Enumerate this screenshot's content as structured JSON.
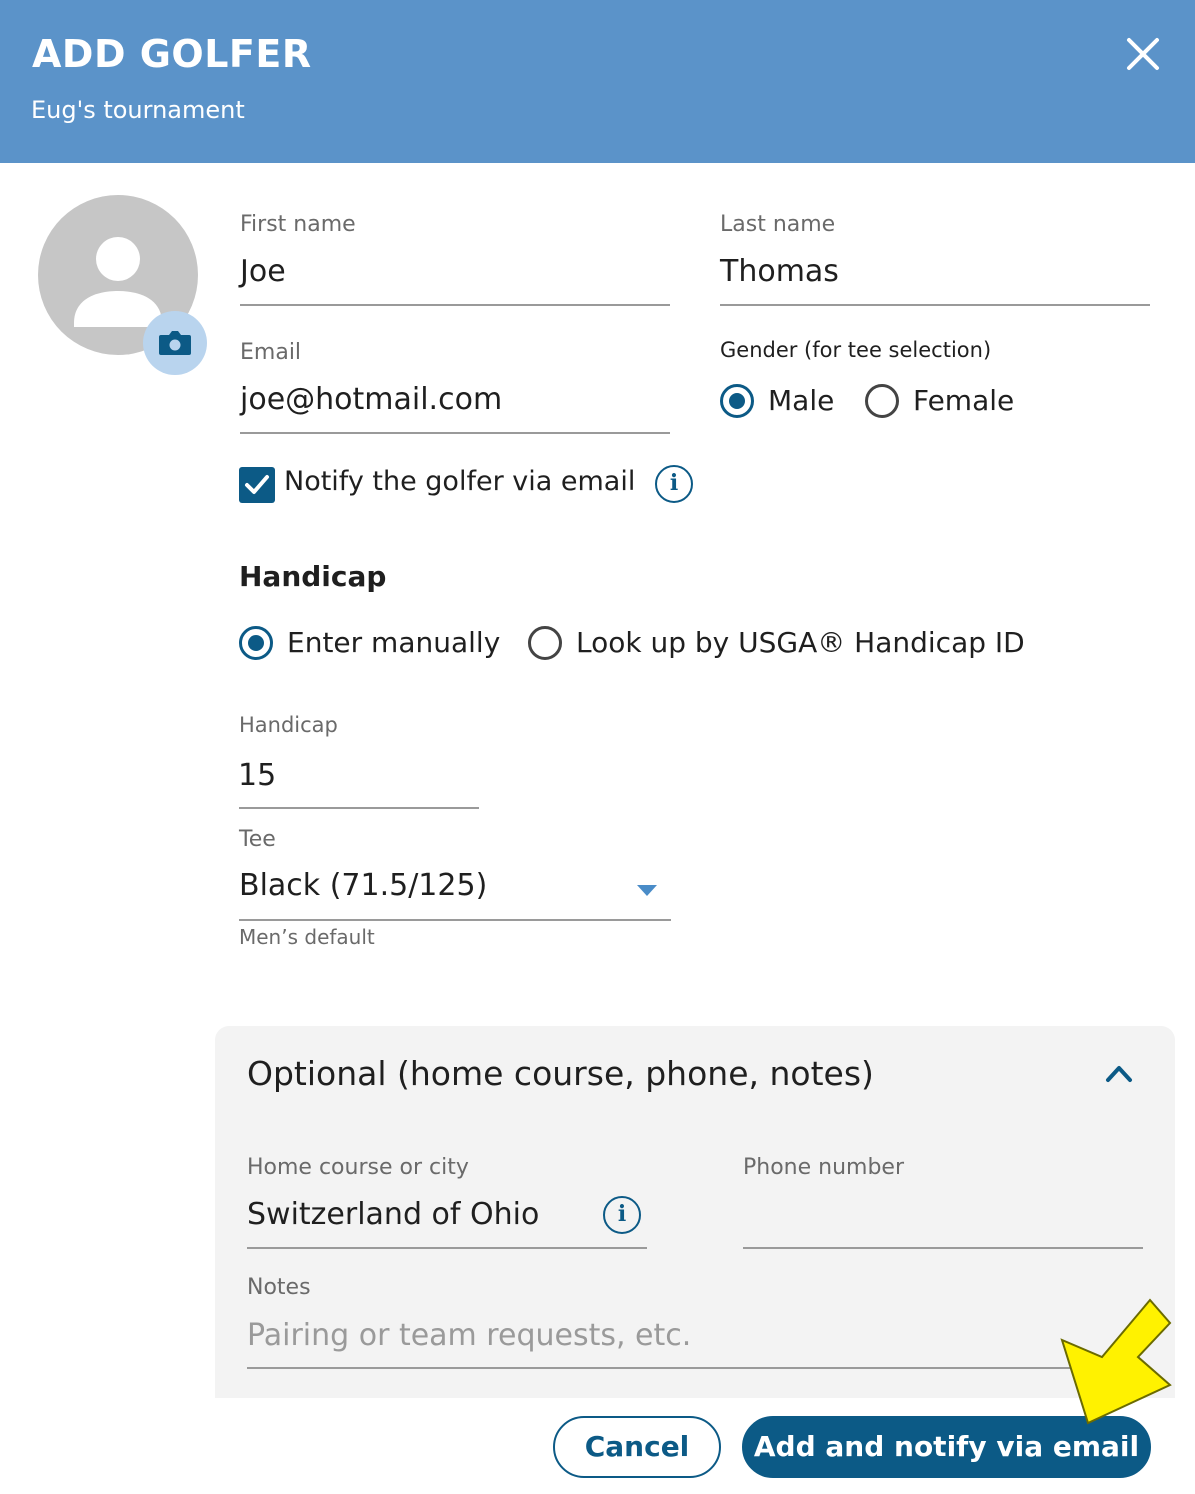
{
  "header": {
    "title": "ADD GOLFER",
    "subtitle": "Eug's tournament",
    "close_icon": "close-icon"
  },
  "colors": {
    "header_bg": "#5b93c9",
    "accent": "#0c5a86",
    "panel_bg": "#f3f3f3",
    "highlight_arrow": "#fff200"
  },
  "form": {
    "first_name": {
      "label": "First name",
      "value": "Joe"
    },
    "last_name": {
      "label": "Last name",
      "value": "Thomas"
    },
    "email": {
      "label": "Email",
      "value": "joe@hotmail.com"
    },
    "gender": {
      "label": "Gender (for tee selection)",
      "options": [
        "Male",
        "Female"
      ],
      "selected": "Male"
    },
    "notify": {
      "label": "Notify the golfer via email",
      "checked": true
    },
    "handicap_section": {
      "title": "Handicap",
      "modes": [
        "Enter manually",
        "Look up by USGA® Handicap ID"
      ],
      "selected_mode": "Enter manually"
    },
    "handicap": {
      "label": "Handicap",
      "value": "15"
    },
    "tee": {
      "label": "Tee",
      "value": "Black (71.5/125)",
      "helper": "Men’s default"
    }
  },
  "optional": {
    "title": "Optional (home course, phone, notes)",
    "expanded": true,
    "home_course": {
      "label": "Home course or city",
      "value": "Switzerland of Ohio"
    },
    "phone": {
      "label": "Phone number",
      "value": ""
    },
    "notes": {
      "label": "Notes",
      "placeholder": "Pairing or team requests, etc."
    }
  },
  "actions": {
    "cancel": "Cancel",
    "primary": "Add and notify via email"
  },
  "icons": {
    "info": "i"
  }
}
